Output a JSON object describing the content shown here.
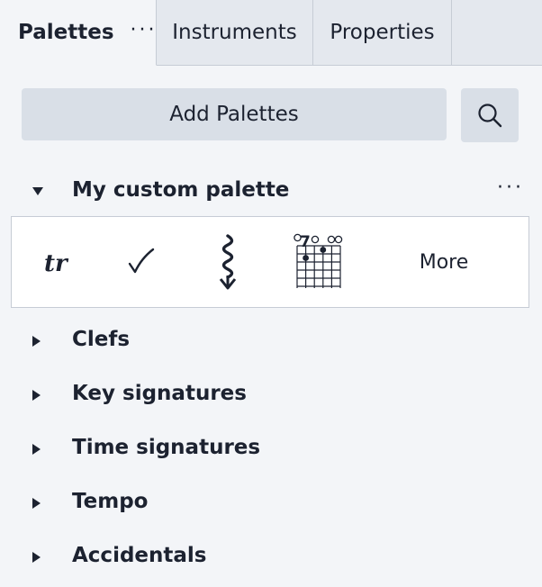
{
  "tabs": [
    {
      "label": "Palettes",
      "more": "···",
      "active": true
    },
    {
      "label": "Instruments",
      "active": false
    },
    {
      "label": "Properties",
      "active": false
    }
  ],
  "toolbar": {
    "add_palettes_label": "Add Palettes",
    "search_icon": "search-icon"
  },
  "custom_palette": {
    "title": "My custom palette",
    "more": "···",
    "expanded": true,
    "cells": [
      {
        "icon": "trill-icon"
      },
      {
        "icon": "checkmark-icon"
      },
      {
        "icon": "arpeggio-down-icon"
      },
      {
        "icon": "fretboard-diagram-icon"
      },
      {
        "label": "More"
      }
    ]
  },
  "sections": [
    {
      "title": "Clefs",
      "expanded": false
    },
    {
      "title": "Key signatures",
      "expanded": false
    },
    {
      "title": "Time signatures",
      "expanded": false
    },
    {
      "title": "Tempo",
      "expanded": false
    },
    {
      "title": "Accidentals",
      "expanded": false
    }
  ],
  "colors": {
    "panel_bg": "#f3f5f8",
    "tab_inactive_bg": "#e4e8ee",
    "button_bg": "#d9dfe7",
    "text": "#1c2230",
    "border": "#c6ccd5"
  }
}
